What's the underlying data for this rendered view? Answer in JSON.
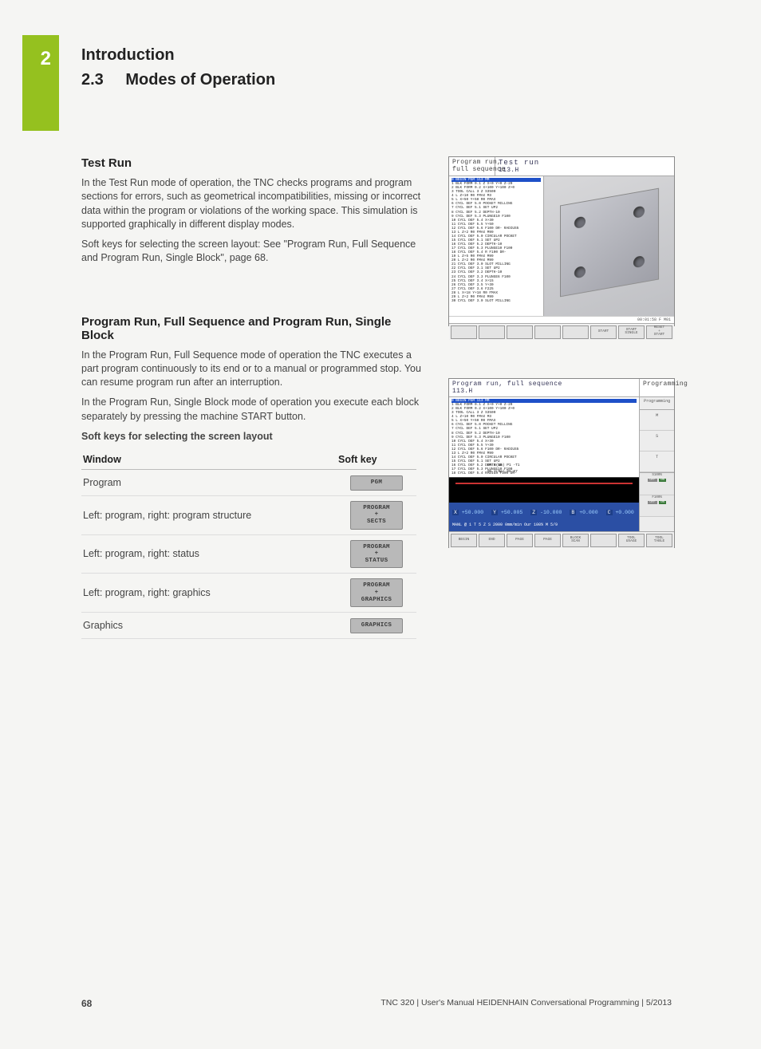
{
  "side_tab": {
    "number": "2"
  },
  "header": {
    "chapter": "Introduction",
    "section_number": "2.3",
    "section_title": "Modes of Operation"
  },
  "section_testrun": {
    "heading": "Test Run",
    "para1": "In the Test Run mode of operation, the TNC checks programs and program sections for errors, such as geometrical incompatibilities, missing or incorrect data within the program or violations of the working space. This simulation is supported graphically in different display modes.",
    "para2": "Soft keys for selecting the screen layout: See \"Program Run, Full Sequence and Program Run, Single Block\", page 68."
  },
  "figure1": {
    "title_left": "Program run,\nfull sequence",
    "title_mid": "Test run",
    "title_file": "113.H",
    "code_highlight": "0  BEGIN PGM 113 MM",
    "code_lines": [
      "1  BLK FORM 0.1 Z X+0 Y+0 Z-20",
      "2  BLK FORM 0.2  X+100  Y+100   Z+0",
      "3  TOOL CALL 3 Z S3500",
      "4  L  Z+10 R0 FMAX M3",
      "5  L   X+50  Y+50 R0 FMAX",
      "6  CYCL DEF 5.0 POCKET MILLING",
      "7  CYCL DEF 5.1 SET UP2",
      "8  CYCL DEF 5.2 DEPTH-10",
      "9  CYCL DEF 5.3 PLUNGE10 F100",
      "10 CYCL DEF 5.4 X+30",
      "11 CYCL DEF 5.5 Y+50",
      "12 CYCL DEF 5.6 F100 DR- RADIUS5",
      "13 L   Z+2 R0 FMAX M99",
      "14 CYCL DEF 5.0 CIRCULAR POCKET",
      "15 CYCL DEF 5.1 SET UP2",
      "16 CYCL DEF 5.2 DEPTH-10",
      "17 CYCL DEF 5.3 PLUNGE10 F100",
      "18 CYCL DEF 5.4 R F100 DR-",
      "19 L   Z+5 R0 FMAX M99",
      "20 L   Z+2 R0 FMAX M99",
      "21 CYCL DEF 3.0 SLOT MILLING",
      "22 CYCL DEF 3.1 SET UP2",
      "23 CYCL DEF 3.2 DEPTH-10",
      "24 CYCL DEF 3.3 PLUNGE6 F100",
      "25 CYCL DEF 3.4 X+15",
      "26 CYCL DEF 3.5 Y+30",
      "27 CYCL DEF 3.6 F225",
      "28 L   X+18  Y+18 R0 FMAX",
      "29 L   Z+2 R0 FMAX M99",
      "30 CYCL DEF 3.0 SLOT MILLING"
    ],
    "info_line": "00:01:58    F M01",
    "softkeys": [
      "",
      "",
      "",
      "",
      "",
      "START",
      "START\nSINGLE",
      "RESET\n+\nSTART"
    ]
  },
  "figure2": {
    "title_left": "Program run, full sequence",
    "title_right": "Programming",
    "title_file": "113.H",
    "code_highlight": "0  BEGIN PGM 113 MM",
    "code_lines": [
      "1  BLK FORM 0.1 Z X+0 Y+0 Z-20",
      "2  BLK FORM 0.2  X+100  Y+100   Z+0",
      "3  TOOL CALL 3 Z S3500",
      "4  L  Z+10 R0 FMAX M3",
      "5  L   X+50  Y+50 R0 FMAX",
      "6  CYCL DEF 5.0 POCKET MILLING",
      "7  CYCL DEF 5.1 SET UP2",
      "8  CYCL DEF 5.2 DEPTH-10",
      "9  CYCL DEF 5.3 PLUNGE10 F100",
      "10 CYCL DEF 5.4 X+30",
      "11 CYCL DEF 5.5 Y+30",
      "12 CYCL DEF 5.6 F100 DR- RADIUS5",
      "13 L   Z+2 R0 FMAX M99",
      "14 CYCL DEF 5.0 CIRCULAR POCKET",
      "15 CYCL DEF 5.1 SET UP2",
      "16 CYCL DEF 5.2 DEPTH-10",
      "17 CYCL DEF 5.3 PLUNGE10 F100",
      "18 CYCL DEF 5.4 RADIUS F100 DR-"
    ],
    "cursor_info": "0% X(Nm) P1  -T1",
    "time_info": "0% Y(Nm)  08:07",
    "axis": {
      "X_label": "X",
      "X_val": "+50.000",
      "Y_label": "Y",
      "Y_val": "+50.005",
      "Z_label": "Z",
      "Z_val": "-10.000",
      "B_label": "B",
      "B_val": "+0.000",
      "C_label": "C",
      "C_val": "+0.000"
    },
    "status_line": "MANL   @ 1        T   5 Z S  2000     0mm/min   Our  100%  M 5/9",
    "right_head": "Programming",
    "right_cells": [
      "M",
      "S",
      "T"
    ],
    "f_cells": [
      {
        "title": "S100%",
        "off": "OFF",
        "on": "ON"
      },
      {
        "title": "F100%",
        "off": "OFF",
        "on": "ON"
      }
    ],
    "softkeys": [
      "BEGIN",
      "END",
      "PAGE",
      "PAGE",
      "BLOCK\nSCAN",
      "",
      "TOOL\nUSAGE",
      "TOOL\nTABLE"
    ]
  },
  "section_programrun": {
    "heading": "Program Run, Full Sequence and Program Run, Single Block",
    "para1": "In the Program Run, Full Sequence mode of operation the TNC executes a part program continuously to its end or to a manual or programmed stop. You can resume program run after an interruption.",
    "para2": "In the Program Run, Single Block mode of operation you execute each block separately by pressing the machine START button.",
    "table_caption": "Soft keys for selecting the screen layout",
    "table": {
      "headers": [
        "Window",
        "Soft key"
      ],
      "rows": [
        {
          "window": "Program",
          "key": "PGM"
        },
        {
          "window": "Left: program, right: program structure",
          "key": "PROGRAM\n+\nSECTS"
        },
        {
          "window": "Left: program, right: status",
          "key": "PROGRAM\n+\nSTATUS"
        },
        {
          "window": "Left: program, right: graphics",
          "key": "PROGRAM\n+\nGRAPHICS"
        },
        {
          "window": "Graphics",
          "key": "GRAPHICS"
        }
      ]
    }
  },
  "footer": {
    "page": "68",
    "text": "TNC 320 | User's Manual HEIDENHAIN Conversational Programming | 5/2013"
  }
}
